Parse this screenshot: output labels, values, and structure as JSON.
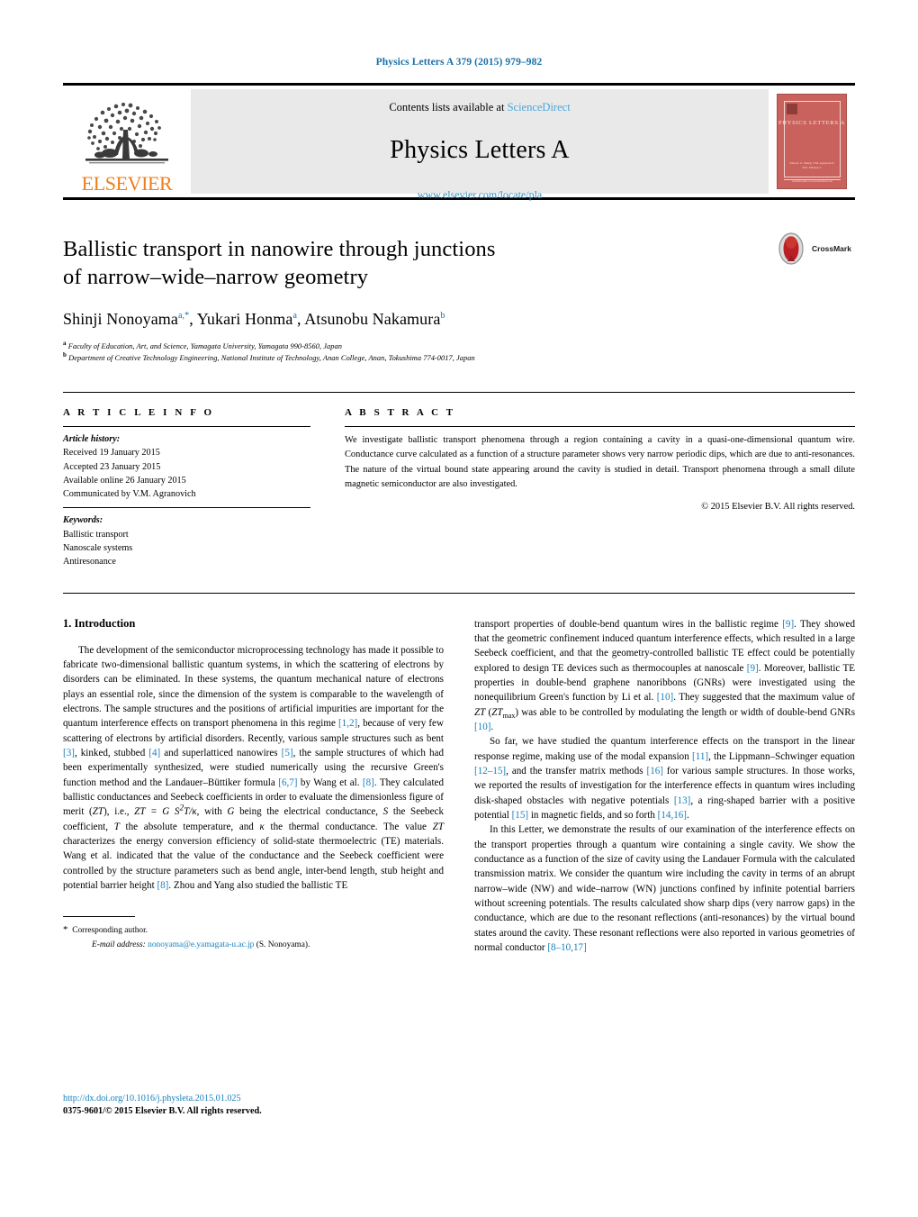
{
  "running_head": "Physics Letters A 379 (2015) 979–982",
  "masthead": {
    "publisher": "ELSEVIER",
    "contents_prefix": "Contents lists available at ",
    "sciencedirect": "ScienceDirect",
    "journal_title": "Physics Letters A",
    "journal_url": "www.elsevier.com/locate/pla",
    "cover_title": "PHYSICS LETTERS A",
    "cover_foot_line1": "Editors: Z. Zheng, V.M. Agranovich",
    "cover_foot_line2": "M.F. Mirtaurov",
    "cover_bottom": "Available online at www.sciencedirect.com"
  },
  "article": {
    "title_line1": "Ballistic transport in nanowire through junctions",
    "title_line2": "of narrow–wide–narrow geometry",
    "authors_html": "Shinji Nonoyama, Yukari Honma, Atsunobu Nakamura",
    "author_1": "Shinji Nonoyama",
    "author_1_sup": "a,*",
    "author_2": "Yukari Honma",
    "author_2_sup": "a",
    "author_3": "Atsunobu Nakamura",
    "author_3_sup": "b",
    "affiliation_a_sup": "a",
    "affiliation_a": "Faculty of Education, Art, and Science, Yamagata University, Yamagata 990-8560, Japan",
    "affiliation_b_sup": "b",
    "affiliation_b": "Department of Creative Technology Engineering, National Institute of Technology, Anan College, Anan, Tokushima 774-0017, Japan",
    "crossmark_label": "CrossMark"
  },
  "info": {
    "heading": "A R T I C L E    I N F O",
    "history_label": "Article history:",
    "history": [
      "Received 19 January 2015",
      "Accepted 23 January 2015",
      "Available online 26 January 2015",
      "Communicated by V.M. Agranovich"
    ],
    "keywords_label": "Keywords:",
    "keywords": [
      "Ballistic transport",
      "Nanoscale systems",
      "Antiresonance"
    ]
  },
  "abstract": {
    "heading": "A B S T R A C T",
    "text": "We investigate ballistic transport phenomena through a region containing a cavity in a quasi-one-dimensional quantum wire. Conductance curve calculated as a function of a structure parameter shows very narrow periodic dips, which are due to anti-resonances. The nature of the virtual bound state appearing around the cavity is studied in detail. Transport phenomena through a small dilute magnetic semiconductor are also investigated.",
    "copyright": "© 2015 Elsevier B.V. All rights reserved."
  },
  "body": {
    "section_title": "1. Introduction",
    "left_para_1_a": "The development of the semiconductor microprocessing technology has made it possible to fabricate two-dimensional ballistic quantum systems, in which the scattering of electrons by disorders can be eliminated. In these systems, the quantum mechanical nature of electrons plays an essential role, since the dimension of the system is comparable to the wavelength of electrons. The sample structures and the positions of artificial impurities are important for the quantum interference effects on transport phenomena in this regime ",
    "ref_1_2": "[1,2]",
    "left_para_1_b": ", because of very few scattering of electrons by artificial disorders. Recently, various sample structures such as bent ",
    "ref_3": "[3]",
    "left_para_1_c": ", kinked, stubbed ",
    "ref_4": "[4]",
    "left_para_1_d": " and superlatticed nanowires ",
    "ref_5": "[5]",
    "left_para_1_e": ", the sample structures of which had been experimentally synthesized, were studied numerically using the recursive Green's function method and the Landauer–Büttiker formula ",
    "ref_6_7": "[6,7]",
    "left_para_1_f": " by Wang et al. ",
    "ref_8": "[8]",
    "left_para_1_g": ". They calculated ballistic conductances and Seebeck coefficients in order to evaluate the dimensionless figure of merit (ZT), i.e., ZT = GS2T/κ, with G being the electrical conductance, S the Seebeck coefficient, T the absolute temperature, and κ the thermal conductance. The value ZT characterizes the energy conversion efficiency of solid-state thermoelectric (TE) materials. Wang et al. indicated that the value of the conductance and the Seebeck coefficient were controlled by the structure parameters such as bend angle, inter-bend length, stub height and potential barrier height ",
    "ref_8b": "[8]",
    "left_para_1_h": ". Zhou and Yang also studied the ballistic TE",
    "right_para_1_a": "transport properties of double-bend quantum wires in the ballistic regime ",
    "ref_9": "[9]",
    "right_para_1_b": ". They showed that the geometric confinement induced quantum interference effects, which resulted in a large Seebeck coefficient, and that the geometry-controlled ballistic TE effect could be potentially explored to design TE devices such as thermocouples at nanoscale ",
    "ref_9b": "[9]",
    "right_para_1_c": ". Moreover, ballistic TE properties in double-bend graphene nanoribbons (GNRs) were investigated using the nonequilibrium Green's function by Li et al. ",
    "ref_10": "[10]",
    "right_para_1_d": ". They suggested that the maximum value of ZT (ZTmax) was able to be controlled by modulating the length or width of double-bend GNRs ",
    "ref_10b": "[10]",
    "right_para_1_e": ".",
    "right_para_2_a": "So far, we have studied the quantum interference effects on the transport in the linear response regime, making use of the modal expansion ",
    "ref_11": "[11]",
    "right_para_2_b": ", the Lippmann–Schwinger equation ",
    "ref_12_15": "[12–15]",
    "right_para_2_c": ", and the transfer matrix methods ",
    "ref_16": "[16]",
    "right_para_2_d": " for various sample structures. In those works, we reported the results of investigation for the interference effects in quantum wires including disk-shaped obstacles with negative potentials ",
    "ref_13": "[13]",
    "right_para_2_e": ", a ring-shaped barrier with a positive potential ",
    "ref_15": "[15]",
    "right_para_2_f": " in magnetic fields, and so forth ",
    "ref_14_16": "[14,16]",
    "right_para_2_g": ".",
    "right_para_3_a": "In this Letter, we demonstrate the results of our examination of the interference effects on the transport properties through a quantum wire containing a single cavity. We show the conductance as a function of the size of cavity using the Landauer Formula with the calculated transmission matrix. We consider the quantum wire including the cavity in terms of an abrupt narrow–wide (NW) and wide–narrow (WN) junctions confined by infinite potential barriers without screening potentials. The results calculated show sharp dips (very narrow gaps) in the conductance, which are due to the resonant reflections (anti-resonances) by the virtual bound states around the cavity. These resonant reflections were also reported in various geometries of normal conductor ",
    "ref_8_10_17": "[8–10,17]"
  },
  "footnote": {
    "star": "*",
    "corresponding": "Corresponding author.",
    "email_label": "E-mail address:",
    "email": "nonoyama@e.yamagata-u.ac.jp",
    "email_owner": "(S. Nonoyama)."
  },
  "footer": {
    "doi": "http://dx.doi.org/10.1016/j.physleta.2015.01.025",
    "issn": "0375-9601/© 2015 Elsevier B.V. All rights reserved."
  },
  "colors": {
    "link": "#1a7fba",
    "heading_blue": "#1a6fa8",
    "elsevier_orange": "#ef7d19",
    "cover_red": "#c9615c",
    "masthead_grey": "#e9e9e9"
  }
}
